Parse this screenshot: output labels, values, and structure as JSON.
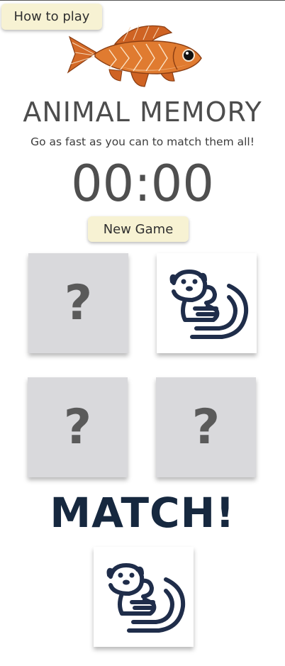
{
  "header": {
    "how_to_play_label": "How to play",
    "title": "ANIMAL MEMORY",
    "subtitle": "Go as fast as you can to match them all!",
    "timer": "00:00",
    "new_game_label": "New Game"
  },
  "logo": {
    "icon": "fish-icon"
  },
  "board": {
    "cards": [
      {
        "state": "hidden",
        "symbol": "?"
      },
      {
        "state": "revealed",
        "icon": "otter-icon"
      },
      {
        "state": "hidden",
        "symbol": "?"
      },
      {
        "state": "hidden",
        "symbol": "?"
      }
    ]
  },
  "match": {
    "text": "MATCH!",
    "icon": "otter-icon"
  },
  "colors": {
    "button_bg": "#f7f2d3",
    "card_back": "#d9d9dc",
    "otter_stroke": "#1f2d4a",
    "match_text": "#16283f",
    "fish_orange": "#d9712a"
  }
}
